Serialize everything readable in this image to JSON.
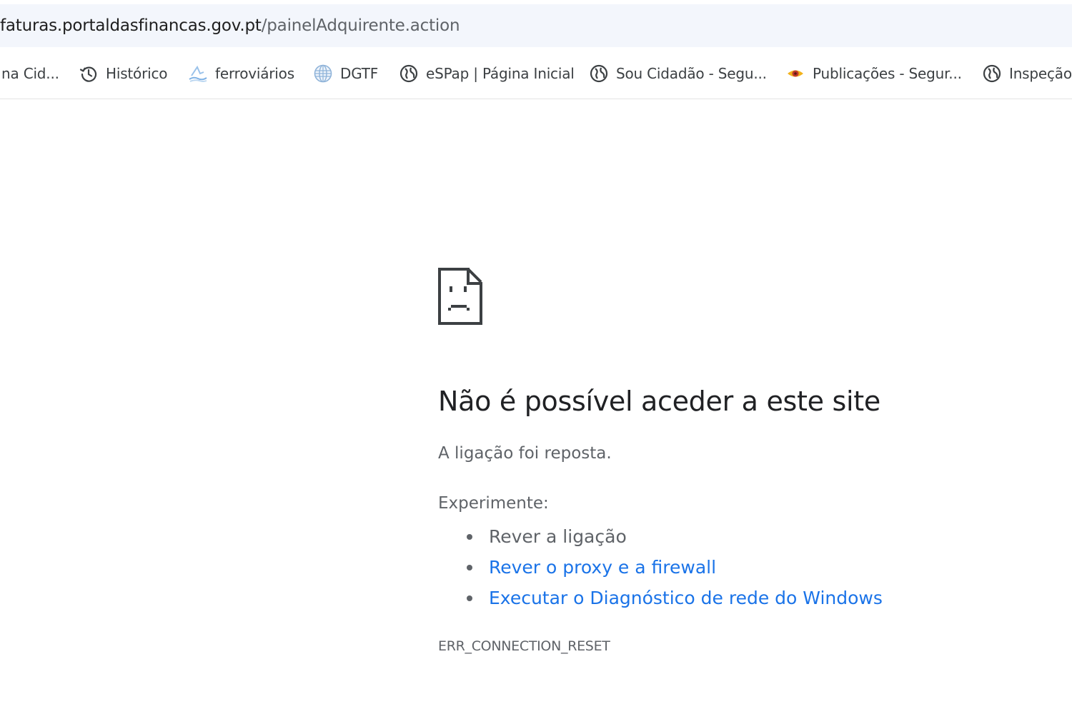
{
  "address_bar": {
    "host": "faturas.portaldasfinancas.gov.pt",
    "path": "/painelAdquirente.action"
  },
  "bookmarks": [
    {
      "label": "na Cid...",
      "icon": "globe-icon"
    },
    {
      "label": "Histórico",
      "icon": "history-icon"
    },
    {
      "label": "ferroviários",
      "icon": "wave-icon"
    },
    {
      "label": "DGTF",
      "icon": "globe-grid-icon"
    },
    {
      "label": "eSPap | Página Inicial",
      "icon": "globe-icon"
    },
    {
      "label": "Sou Cidadão - Segu...",
      "icon": "globe-icon"
    },
    {
      "label": "Publicações - Segur...",
      "icon": "eye-icon"
    },
    {
      "label": "Inspeção",
      "icon": "globe-icon"
    }
  ],
  "error": {
    "icon": "sad-page-icon",
    "title": "Não é possível aceder a este site",
    "reason": "A ligação foi reposta.",
    "try_label": "Experimente:",
    "suggestions": [
      {
        "text": "Rever a ligação",
        "is_link": false
      },
      {
        "text": "Rever o proxy e a firewall",
        "is_link": true
      },
      {
        "text": "Executar o Diagnóstico de rede do Windows",
        "is_link": true
      }
    ],
    "code": "ERR_CONNECTION_RESET"
  },
  "colors": {
    "link": "#1a73e8",
    "text_secondary": "#5f6368",
    "text_primary": "#202124",
    "address_bar_bg": "#f3f6fc"
  }
}
